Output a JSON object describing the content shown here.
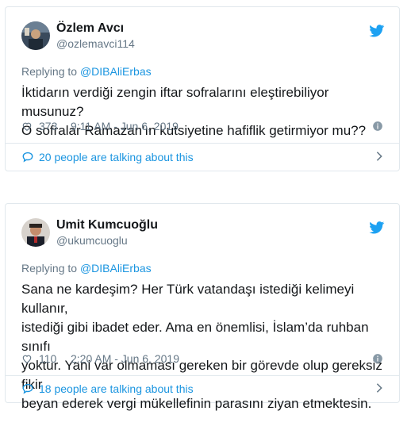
{
  "tweets": [
    {
      "name": "Özlem Avcı",
      "handle": "@ozlemavci114",
      "replying_prefix": "Replying to ",
      "replying_to": "@DIBAliErbas",
      "text_lines": [
        "İktidarın verdiği zengin iftar sofralarını eleştirebiliyor musunuz?",
        "O sofralar Ramazan'ın kutsiyetine hafiflik getirmiyor mu??"
      ],
      "likes": "373",
      "timestamp": "9:11 AM - Jun 6, 2019",
      "talking": "20 people are talking about this",
      "icons": {
        "avatar": "avatar-photo",
        "bird": "twitter-bird-icon",
        "heart": "heart-icon",
        "info": "info-icon",
        "bubble": "speech-bubble-icon",
        "chevron": "chevron-right-icon"
      }
    },
    {
      "name": "Umit Kumcuoğlu",
      "handle": "@ukumcuoglu",
      "replying_prefix": "Replying to ",
      "replying_to": "@DIBAliErbas",
      "text_lines": [
        "Sana ne kardeşim? Her Türk vatandaşı istediği kelimeyi kullanır,",
        "istediği gibi ibadet eder. Ama en önemlisi, İslam’da ruhban sınıfı",
        "yoktur. Yani var olmaması gereken bir görevde olup gereksiz fikir",
        "beyan ederek vergi mükellefinin parasını ziyan etmektesin."
      ],
      "likes": "110",
      "timestamp": "2:20 AM - Jun 6, 2019",
      "talking": "18 people are talking about this",
      "icons": {
        "avatar": "avatar-photo",
        "bird": "twitter-bird-icon",
        "heart": "heart-icon",
        "info": "info-icon",
        "bubble": "speech-bubble-icon",
        "chevron": "chevron-right-icon"
      }
    }
  ],
  "colors": {
    "link": "#1b95e0",
    "muted": "#657786",
    "text": "#14171a",
    "border": "#e1e8ed",
    "bird": "#1da1f2"
  }
}
